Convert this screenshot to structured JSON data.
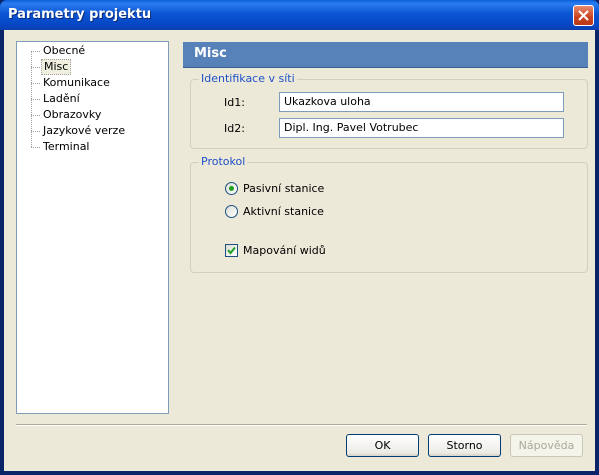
{
  "window": {
    "title": "Parametry projektu"
  },
  "tree": {
    "items": [
      {
        "label": "Obecné",
        "selected": false
      },
      {
        "label": "Misc",
        "selected": true
      },
      {
        "label": "Komunikace",
        "selected": false
      },
      {
        "label": "Ladění",
        "selected": false
      },
      {
        "label": "Obrazovky",
        "selected": false
      },
      {
        "label": "Jazykové verze",
        "selected": false
      },
      {
        "label": "Terminal",
        "selected": false
      }
    ]
  },
  "panel": {
    "header": "Misc",
    "identification": {
      "group_title": "Identifikace v síti",
      "id1_label": "Id1:",
      "id1_value": "Ukazkova uloha",
      "id2_label": "Id2:",
      "id2_value": "Dipl. Ing. Pavel Votrubec"
    },
    "protocol": {
      "group_title": "Protokol",
      "passive_label": "Pasivní stanice",
      "passive_checked": true,
      "active_label": "Aktivní stanice",
      "active_checked": false,
      "mapping_label": "Mapování widů",
      "mapping_checked": true
    }
  },
  "buttons": {
    "ok": "OK",
    "cancel": "Storno",
    "help": "Nápověda"
  },
  "colors": {
    "titlebar": "#0a55d4",
    "header": "#5782b9",
    "group_title": "#1e50c8"
  }
}
